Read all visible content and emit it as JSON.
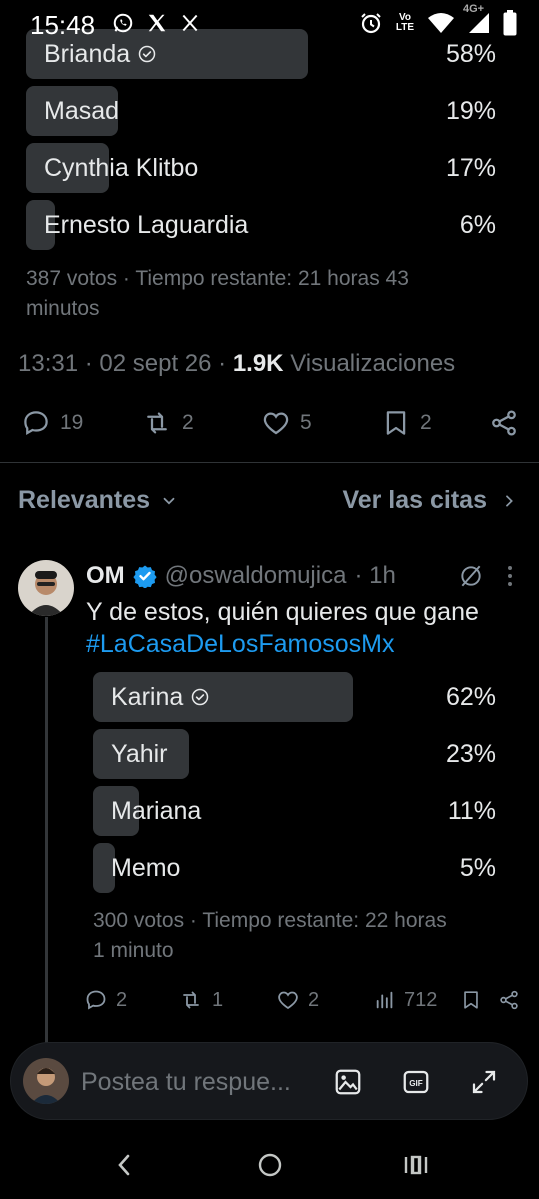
{
  "status_bar": {
    "time": "15:48",
    "left_icons": [
      "whatsapp-icon",
      "x-logo-icon",
      "x-logo-icon"
    ],
    "right_icons": [
      "alarm-icon",
      "volte-icon",
      "wifi-icon",
      "signal-4g-icon",
      "battery-icon"
    ],
    "network_label": "4G+",
    "volte_label": "Vo LTE"
  },
  "poll": {
    "options": [
      {
        "label": "Brianda",
        "percent": "58%",
        "fraction": 0.58,
        "winner": true
      },
      {
        "label": "Masad",
        "percent": "19%",
        "fraction": 0.19,
        "winner": false
      },
      {
        "label": "Cynthia Klitbo",
        "percent": "17%",
        "fraction": 0.17,
        "winner": false
      },
      {
        "label": "Ernesto Laguardia",
        "percent": "6%",
        "fraction": 0.06,
        "winner": false
      }
    ],
    "meta_line1": "387 votos · Tiempo restante: 21 horas 43",
    "meta_line2": "minutos"
  },
  "tweet_meta": {
    "time": "13:31",
    "sep": " · ",
    "date": "02 sept 26",
    "views_count": "1.9K",
    "views_label": "Visualizaciones"
  },
  "tweet_actions": {
    "replies": "19",
    "reposts": "2",
    "likes": "5",
    "bookmarks": "2"
  },
  "filter": {
    "sort_label": "Relevantes",
    "quotes_label": "Ver las citas"
  },
  "reply": {
    "name": "OM",
    "handle": "@oswaldomujica",
    "time": "· 1h",
    "text": "Y de estos, quién quieres que gane",
    "hashtag": "#LaCasaDeLosFamososMx",
    "poll": {
      "options": [
        {
          "label": "Karina",
          "percent": "62%",
          "fraction": 0.62,
          "winner": true
        },
        {
          "label": "Yahir",
          "percent": "23%",
          "fraction": 0.23,
          "winner": false
        },
        {
          "label": "Mariana",
          "percent": "11%",
          "fraction": 0.11,
          "winner": false
        },
        {
          "label": "Memo",
          "percent": "5%",
          "fraction": 0.05,
          "winner": false
        }
      ],
      "meta_line1": "300 votos · Tiempo restante: 22 horas",
      "meta_line2": "1 minuto"
    },
    "actions": {
      "replies": "2",
      "reposts": "1",
      "likes": "2",
      "views": "712"
    }
  },
  "composer": {
    "placeholder": "Postea tu respue..."
  },
  "colors": {
    "background": "#000000",
    "accent": "#1d9bf0",
    "muted": "#71767b",
    "poll_bar": "#333639"
  }
}
